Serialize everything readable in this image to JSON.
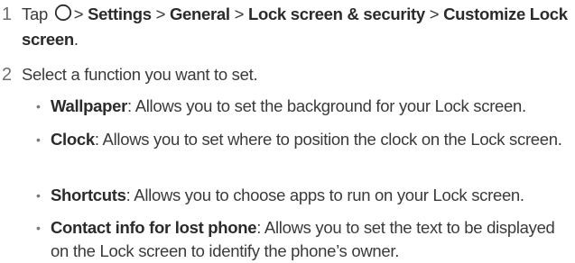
{
  "steps": [
    {
      "number": "1",
      "tap": "Tap",
      "gt": ">",
      "path": [
        "Settings",
        "General",
        "Lock screen & security",
        "Customize Lock screen"
      ],
      "end": "."
    },
    {
      "number": "2",
      "text": "Select a function you want to set."
    }
  ],
  "bullets": [
    {
      "term": "Wallpaper",
      "desc": ": Allows you to set the background for your Lock screen."
    },
    {
      "term": "Clock",
      "desc": ": Allows you to set where to position the clock on the Lock screen."
    },
    {
      "term": "Shortcuts",
      "desc": ": Allows you to choose apps to run on your Lock screen."
    },
    {
      "term": "Contact info for lost phone",
      "desc": ": Allows you to set the text to be displayed on the Lock screen to identify the phone’s owner."
    }
  ],
  "icons": {
    "home": "home-circle-icon",
    "bullet": "•"
  }
}
